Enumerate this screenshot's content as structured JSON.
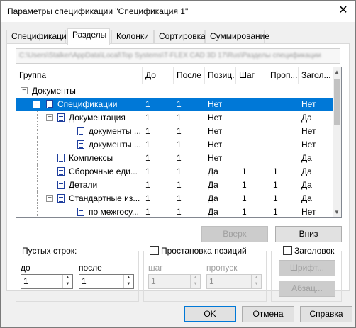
{
  "window": {
    "title": "Параметры спецификации \"Спецификация 1\"",
    "close_glyph": "✕"
  },
  "tabs": [
    {
      "label": "Спецификация"
    },
    {
      "label": "Разделы"
    },
    {
      "label": "Колонки"
    },
    {
      "label": "Сортировка"
    },
    {
      "label": "Суммирование"
    }
  ],
  "path": {
    "value": "C:\\Users\\Stalker\\AppData\\Local\\Top Systems\\T-FLEX CAD 3D 17\\Rus\\Разделы спецификации"
  },
  "table": {
    "columns": [
      "Группа",
      "До",
      "После",
      "Позиц...",
      "Шаг",
      "Проп...",
      "Загол..."
    ],
    "rows": [
      {
        "name": "Документы",
        "do": "",
        "after": "",
        "pos": "",
        "step": "",
        "skip": "",
        "head": ""
      },
      {
        "name": "Спецификации",
        "do": "1",
        "after": "1",
        "pos": "Нет",
        "step": "",
        "skip": "",
        "head": "Нет"
      },
      {
        "name": "Документация",
        "do": "1",
        "after": "1",
        "pos": "Нет",
        "step": "",
        "skip": "",
        "head": "Да"
      },
      {
        "name": "документы ...",
        "do": "1",
        "after": "1",
        "pos": "Нет",
        "step": "",
        "skip": "",
        "head": "Нет"
      },
      {
        "name": "документы ...",
        "do": "1",
        "after": "1",
        "pos": "Нет",
        "step": "",
        "skip": "",
        "head": "Нет"
      },
      {
        "name": "Комплексы",
        "do": "1",
        "after": "1",
        "pos": "Нет",
        "step": "",
        "skip": "",
        "head": "Да"
      },
      {
        "name": "Сборочные еди...",
        "do": "1",
        "after": "1",
        "pos": "Да",
        "step": "1",
        "skip": "1",
        "head": "Да"
      },
      {
        "name": "Детали",
        "do": "1",
        "after": "1",
        "pos": "Да",
        "step": "1",
        "skip": "1",
        "head": "Да"
      },
      {
        "name": "Стандартные из...",
        "do": "1",
        "after": "1",
        "pos": "Да",
        "step": "1",
        "skip": "1",
        "head": "Да"
      },
      {
        "name": "по межгосу...",
        "do": "1",
        "after": "1",
        "pos": "Да",
        "step": "1",
        "skip": "1",
        "head": "Нет"
      }
    ]
  },
  "buttons": {
    "up": "Вверх",
    "down": "Вниз",
    "font": "Шрифт...",
    "para": "Абзац...",
    "ok": "OK",
    "cancel": "Отмена",
    "help": "Справка"
  },
  "empty_rows": {
    "title": "Пустых строк:",
    "before_label": "до",
    "before_value": "1",
    "after_label": "после",
    "after_value": "1"
  },
  "positions": {
    "title": "Простановка позиций",
    "step_label": "шаг",
    "step_value": "1",
    "skip_label": "пропуск",
    "skip_value": "1"
  },
  "header_group": {
    "title": "Заголовок"
  },
  "colors": {
    "selection": "#0078d7",
    "default_border": "#0078d7"
  }
}
